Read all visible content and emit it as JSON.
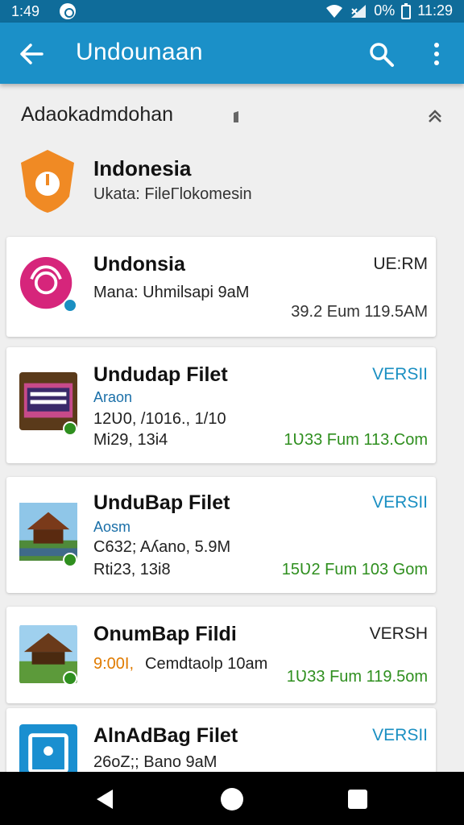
{
  "status_bar": {
    "time_left": "1:49",
    "battery": "0%",
    "time_right": "11:29"
  },
  "app_bar": {
    "title": "Undounaan"
  },
  "section": {
    "title": "Adaokadmdohan"
  },
  "featured": {
    "name": "Indonesia",
    "subtitle": "Ukata: FileΓlokomesin",
    "icon_color": "#f08a24"
  },
  "cards": [
    {
      "name": "Undonsia",
      "badge": "UE:RM",
      "line1": "Mana: Uhmilsapi 9aM",
      "right1": "39.2 Eum 119.5AM"
    },
    {
      "name": "Undudap Filet",
      "badge": "VERSII",
      "tag": "Araon",
      "line1": "12Ʋ0, /1016., 1/10",
      "line2": "Mi29, 13i4",
      "right1": "1Ʋ33 Fum 113.Com"
    },
    {
      "name": "UnduBap Filet",
      "badge": "VERSII",
      "tag": "Aosm",
      "line1": "C632; Aʎano, 5.9M",
      "line2": "Rti23, 13i8",
      "right1": "15Ʋ2 Fum 103 Gom"
    },
    {
      "name": "OnumBap Fildi",
      "badge": "VERSH",
      "line1_accent": "9:00I,",
      "line1": "Cemdtaolp 10am",
      "right1": "1Ʋ33 Fum 119.5om"
    },
    {
      "name": "AlnAdBag Filet",
      "badge": "VERSII",
      "line1": "26oZ;; Bano 9aM"
    }
  ],
  "colors": {
    "app_bar": "#1b90c8",
    "status_bar": "#0f6c9a",
    "badge_blue": "#1a8fc2",
    "green": "#2f8f1f",
    "orange": "#e07b00",
    "pink_icon": "#d6257b"
  }
}
